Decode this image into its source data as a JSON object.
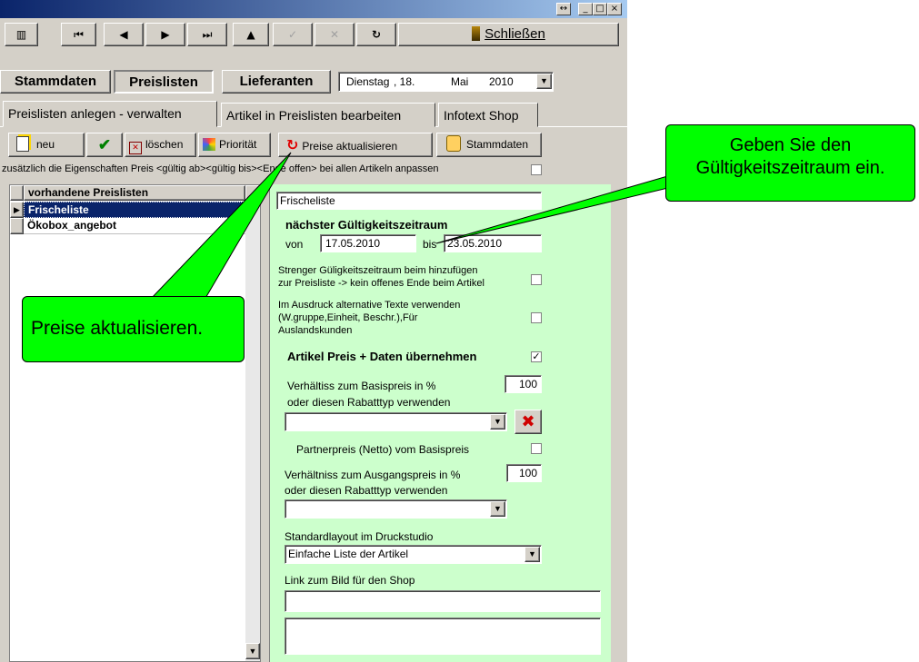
{
  "window": {
    "title": "",
    "close_glyph": "×",
    "max_glyph": "□",
    "min_glyph": "_",
    "restore_glyph": "↔"
  },
  "navbar": {
    "columns_glyph": "▥",
    "first_glyph": "⏮",
    "prev_glyph": "◀",
    "next_glyph": "▶",
    "last_glyph": "⏭",
    "up_glyph": "▲",
    "check_glyph": "✓",
    "cancel_glyph": "✕",
    "refresh_glyph": "↻",
    "close_label": "Schließen"
  },
  "main_tabs": {
    "stammdaten": "Stammdaten",
    "preislisten": "Preislisten",
    "lieferanten": "Lieferanten"
  },
  "date": {
    "weekday": "Dienstag",
    "day": ", 18.",
    "month": "Mai",
    "year": "2010"
  },
  "sub_tabs": [
    "Preislisten anlegen - verwalten",
    "Artikel in Preislisten bearbeiten",
    "Infotext Shop"
  ],
  "toolbar": {
    "neu": "neu",
    "ok_glyph": "✔",
    "loeschen": "löschen",
    "prioritaet": "Priorität",
    "preise_aktualisieren": "Preise aktualisieren",
    "stammdaten": "Stammdaten"
  },
  "adjust_note": "zusätzlich die Eigenschaften Preis <gültig ab><gültig bis><Ende offen> bei allen Artikeln anpassen",
  "list": {
    "header": "vorhandene Preislisten",
    "items": [
      "Frischeliste",
      "Ökobox_angebot"
    ],
    "selected_index": 0
  },
  "detail": {
    "name_value": "Frischeliste",
    "period_title": "nächster Gültigkeitszeitraum",
    "von_label": "von",
    "von_value": "17.05.2010",
    "bis_label": "bis",
    "bis_value": "23.05.2010",
    "strict_label_1": "Strenger Güligkeitszeitraum beim hinzufügen",
    "strict_label_2": "zur Preisliste -> kein offenes Ende beim Artikel",
    "strict_checked": false,
    "alt_label_1": "Im Ausdruck alternative Texte verwenden",
    "alt_label_2": "(W.gruppe,Einheit, Beschr.),Für",
    "alt_label_3": "Auslandskunden",
    "alt_checked": false,
    "take_label": "Artikel Preis + Daten  übernehmen",
    "take_checked": true,
    "ratio_label": "Verhältiss zum Basispreis in %",
    "ratio_value": "100",
    "rabatt_label_1": "oder diesen Rabatttyp verwenden",
    "rabatt_value_1": "",
    "delete_glyph": "✖",
    "partner_label": "Partnerpreis (Netto) vom Basispreis",
    "partner_checked": false,
    "ratio2_label": "Verhältniss zum Ausgangspreis in %",
    "ratio2_value": "100",
    "rabatt_label_2": "oder diesen Rabatttyp verwenden",
    "rabatt_value_2": "",
    "layout_label": "Standardlayout im Druckstudio",
    "layout_value": "Einfache Liste der Artikel",
    "link_label": "Link zum Bild für den Shop",
    "link_value": "",
    "memo_value": ""
  },
  "callouts": {
    "right": "Geben Sie den Gültigkeitszeitraum ein.",
    "left": "Preise aktualisieren."
  },
  "colors": {
    "callout": "#00ff00",
    "panel": "#ccffcc",
    "selection": "#0a246a"
  }
}
